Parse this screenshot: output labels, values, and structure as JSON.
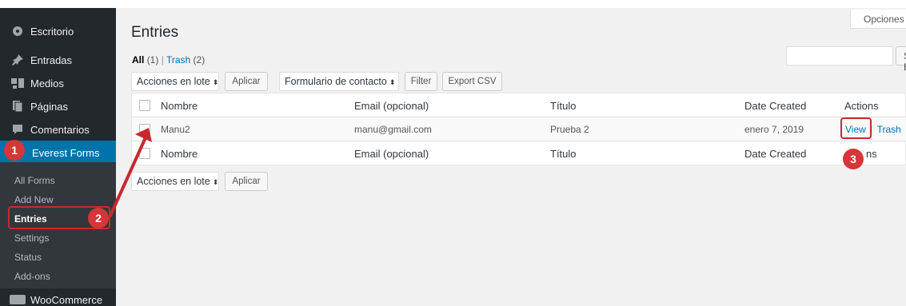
{
  "sidebar": {
    "items": [
      {
        "label": "Escritorio",
        "icon": "dashboard-icon"
      },
      {
        "label": "Entradas",
        "icon": "pin-icon"
      },
      {
        "label": "Medios",
        "icon": "media-icon"
      },
      {
        "label": "Páginas",
        "icon": "pages-icon"
      },
      {
        "label": "Comentarios",
        "icon": "comments-icon"
      },
      {
        "label": "Everest Forms",
        "icon": "everest-forms-icon"
      }
    ],
    "submenu": [
      "All Forms",
      "Add New",
      "Entries",
      "Settings",
      "Status",
      "Add-ons"
    ],
    "woocommerce_label": "WooCommerce"
  },
  "header": {
    "screen_options": "Opciones de pantalla",
    "title": "Entries"
  },
  "views": {
    "all_label": "All",
    "all_count": "(1)",
    "separator": "|",
    "trash_label": "Trash",
    "trash_count": "(2)"
  },
  "search": {
    "button_label": "Search Entries",
    "placeholder": ""
  },
  "toolbar_top": {
    "bulk_actions": "Acciones en lote",
    "apply": "Aplicar",
    "form_select": "Formulario de contacto",
    "filter": "Filter",
    "export": "Export CSV"
  },
  "table": {
    "columns": [
      "Nombre",
      "Email (opcional)",
      "Título",
      "Date Created",
      "Actions"
    ],
    "rows": [
      {
        "nombre": "Manu2",
        "email": "manu@gmail.com",
        "titulo": "Prueba 2",
        "date": "enero 7, 2019",
        "view": "View",
        "trash": "Trash"
      }
    ],
    "footer_actions_partial": "ns"
  },
  "toolbar_bottom": {
    "bulk_actions": "Acciones en lote",
    "apply": "Aplicar"
  },
  "annotations": [
    "1",
    "2",
    "3"
  ],
  "colors": {
    "sidebar_bg": "#23282d",
    "submenu_bg": "#32373c",
    "active_bg": "#0073aa",
    "link": "#0073aa",
    "annotation_red": "#d63638"
  }
}
